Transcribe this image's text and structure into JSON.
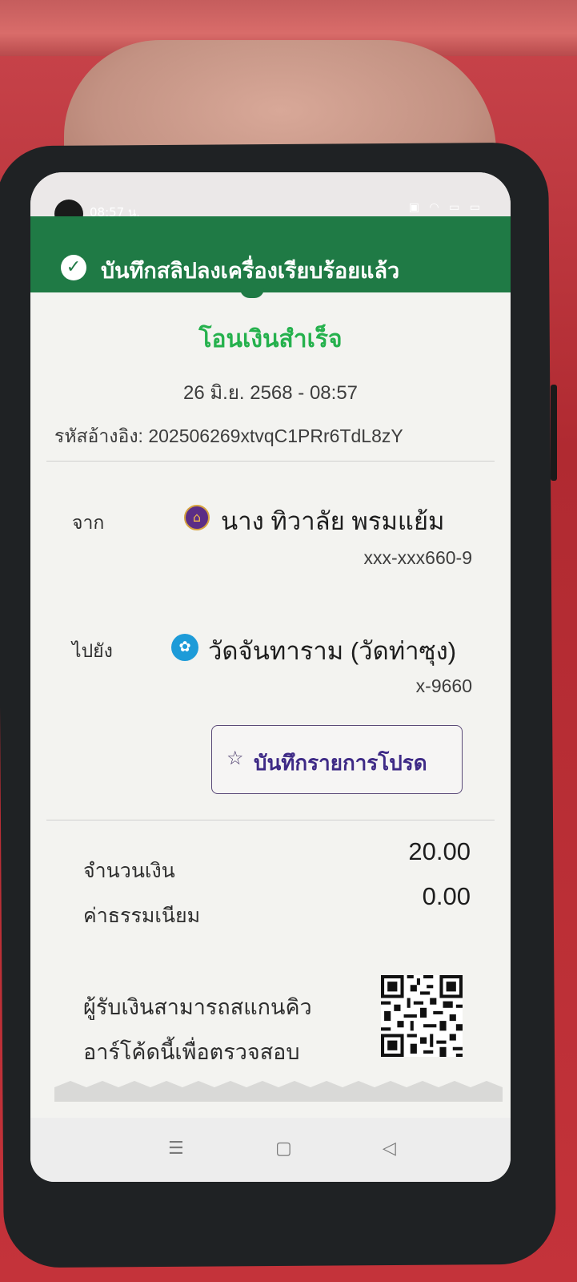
{
  "status_bar": {
    "time": "08:57 น.",
    "icons": [
      "sim-icon",
      "wifi-icon",
      "battery-saver-icon",
      "battery-icon"
    ]
  },
  "banner": {
    "text": "บันทึกสลิปลงเครื่องเรียบร้อยแล้ว",
    "icon": "check-circle-icon"
  },
  "receipt": {
    "title": "โอนเงินสำเร็จ",
    "datetime": "26 มิ.ย. 2568 - 08:57",
    "reference": "รหัสอ้างอิง: 202506269xtvqC1PRr6TdL8zY",
    "from": {
      "label": "จาก",
      "name": "นาง ทิวาลัย พรมแย้ม",
      "account": "xxx-xxx660-9",
      "bank_icon": "scb-bank-icon",
      "bank_color": "#5b2d86"
    },
    "to": {
      "label": "ไปยัง",
      "name": "วัดจันทาราม (วัดท่าซุง)",
      "account": "x-9660",
      "bank_icon": "ktb-bank-icon",
      "bank_color": "#1d9bd8"
    },
    "favorite_button": {
      "label": "บันทึกรายการโปรด",
      "icon": "star-icon"
    },
    "amount": {
      "label": "จำนวนเงิน",
      "value": "20.00"
    },
    "fee": {
      "label": "ค่าธรรมเนียม",
      "value": "0.00"
    },
    "qr_note": {
      "line1": "ผู้รับเงินสามารถสแกนคิว",
      "line2": "อาร์โค้ดนี้เพื่อตรวจสอบ"
    }
  },
  "nav": {
    "recent_icon": "menu-icon",
    "home_icon": "square-icon",
    "back_icon": "back-triangle-icon",
    "recent_glyph": "☰",
    "home_glyph": "▢",
    "back_glyph": "◁"
  },
  "colors": {
    "banner_green": "#1f7a45",
    "success_green": "#25b14d",
    "favorite_purple": "#3e2a86"
  }
}
